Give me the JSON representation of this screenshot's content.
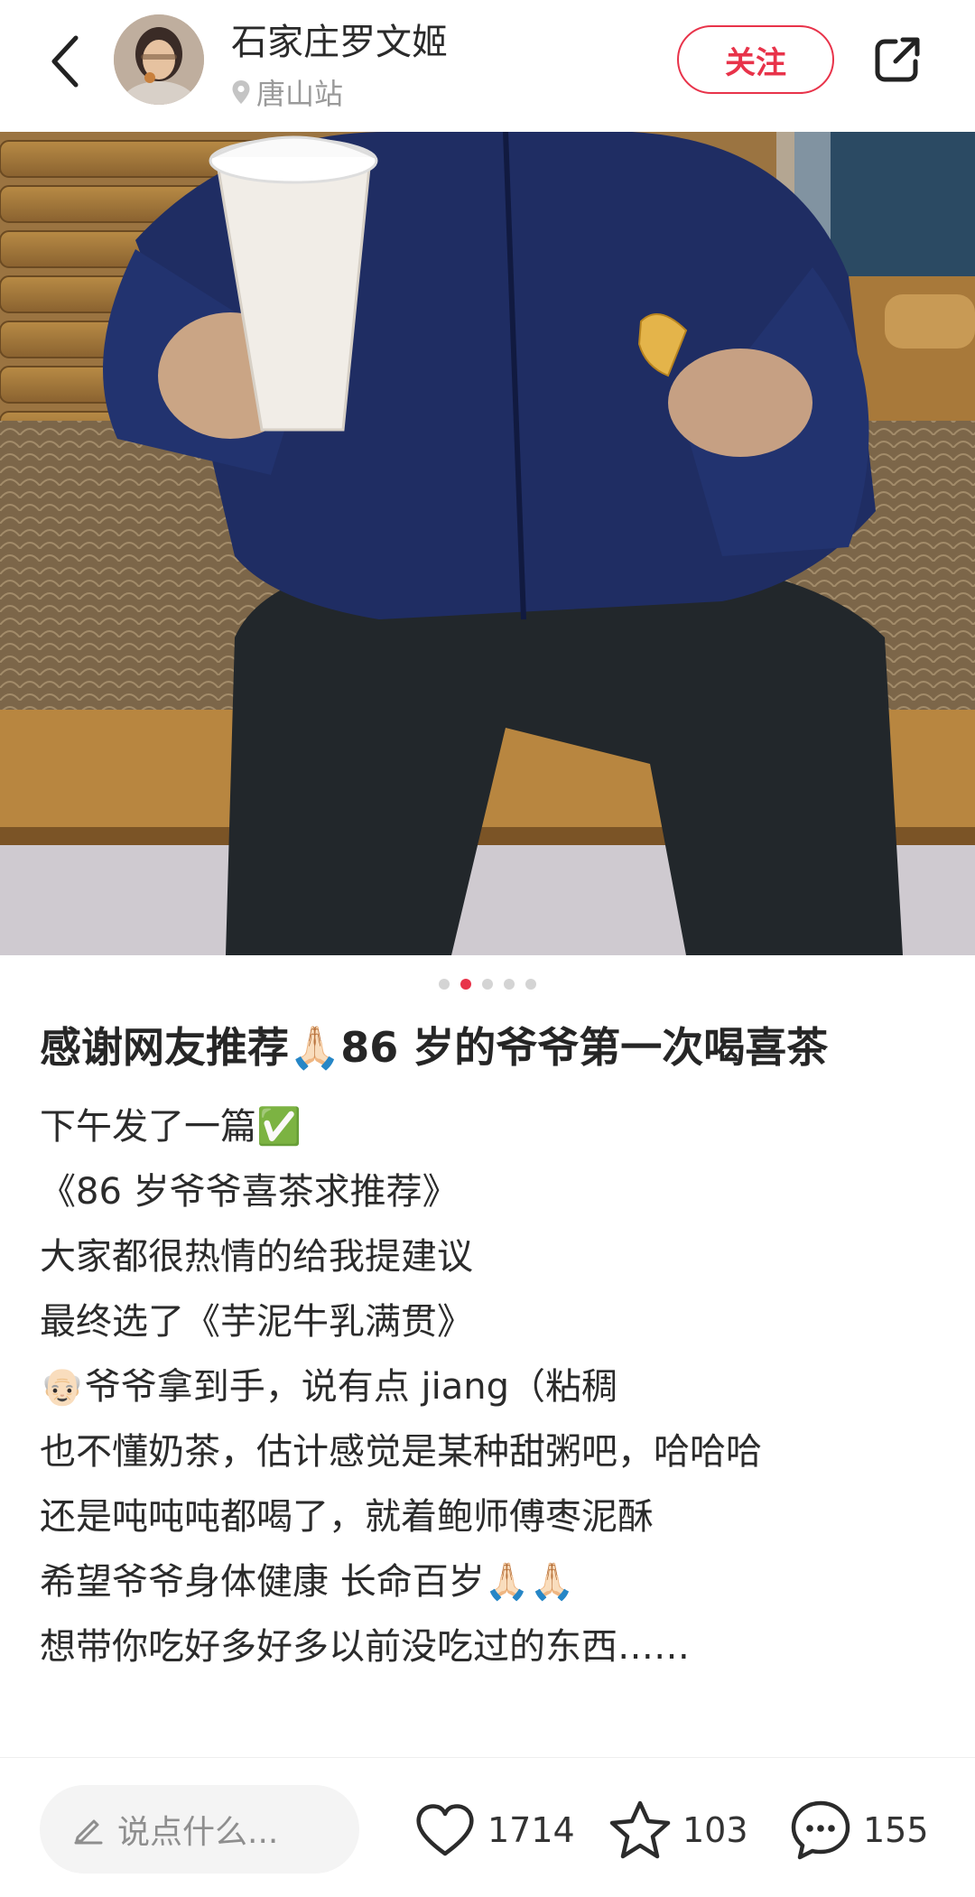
{
  "header": {
    "author_name": "石家庄罗文姬",
    "location": "唐山站",
    "follow_label": "关注"
  },
  "carousel": {
    "total": 5,
    "active_index": 1
  },
  "post": {
    "title": "感谢网友推荐🙏🏻86 岁的爷爷第一次喝喜茶",
    "lines": [
      "下午发了一篇✅",
      "《86 岁爷爷喜茶求推荐》",
      "大家都很热情的给我提建议",
      "最终选了《芋泥牛乳满贯》",
      "👴🏻爷爷拿到手，说有点 jiang（粘稠",
      "也不懂奶茶，估计感觉是某种甜粥吧，哈哈哈",
      "还是吨吨吨都喝了，就着鲍师傅枣泥酥",
      "希望爷爷身体健康 长命百岁🙏🏻🙏🏻",
      "想带你吃好多好多以前没吃过的东西……"
    ]
  },
  "bottom_bar": {
    "comment_placeholder": "说点什么...",
    "likes": "1714",
    "collects": "103",
    "comments": "155"
  },
  "colors": {
    "accent": "#e8334a",
    "muted": "#9a9a9a"
  },
  "icons": {
    "back": "chevron-left-icon",
    "location": "location-pin-icon",
    "share": "share-icon",
    "edit": "pencil-icon",
    "like": "heart-icon",
    "collect": "star-icon",
    "comment": "chat-bubble-icon"
  }
}
